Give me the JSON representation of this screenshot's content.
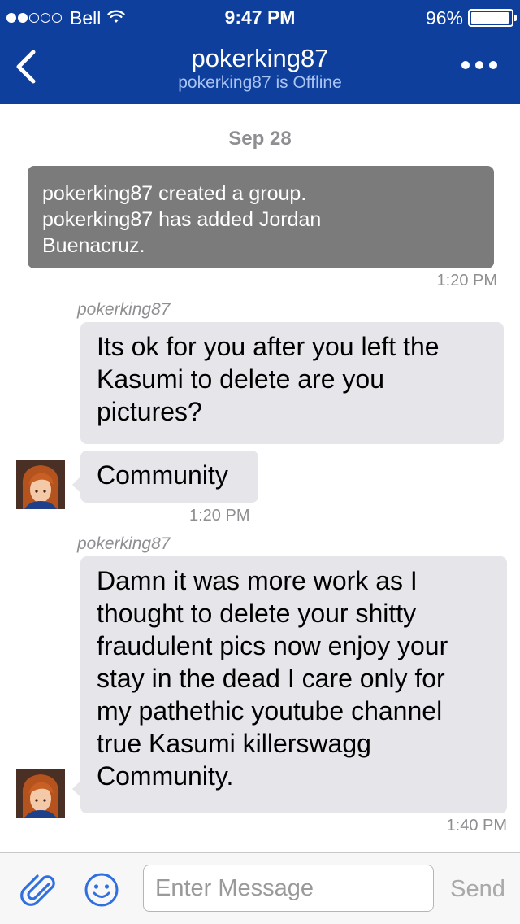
{
  "status_bar": {
    "carrier": "Bell",
    "time": "9:47 PM",
    "battery_percent": "96%",
    "battery_level": 0.96,
    "signal_bars_filled": 2,
    "signal_bars_total": 5
  },
  "nav": {
    "title": "pokerking87",
    "subtitle": "pokerking87 is Offline",
    "back_icon": "chevron-left-icon",
    "more_icon": "ellipsis-icon"
  },
  "conversation": {
    "date_separator": "Sep 28",
    "system_message": {
      "lines": [
        "pokerking87 created a group.",
        "pokerking87 has added Jordan",
        "Buenacruz."
      ],
      "time": "1:20 PM"
    },
    "groups": [
      {
        "sender": "pokerking87",
        "messages": [
          {
            "lines": [
              "Its ok for you after you left the",
              "Kasumi to delete are you",
              "pictures?"
            ]
          },
          {
            "lines": [
              "Community"
            ]
          }
        ],
        "time": "1:20 PM"
      },
      {
        "sender": "pokerking87",
        "messages": [
          {
            "lines": [
              "Damn it was more work as I",
              "thought to delete your shitty",
              "fraudulent pics now enjoy your",
              "stay in the dead I care only for",
              "my pathethic youtube channel",
              "true Kasumi killerswagg",
              "Community."
            ]
          }
        ],
        "time": "1:40 PM"
      }
    ]
  },
  "input_bar": {
    "placeholder": "Enter Message",
    "value": "",
    "send_label": "Send",
    "attach_icon": "paperclip-icon",
    "emoji_icon": "smiley-icon"
  },
  "colors": {
    "nav_background": "#0e3f9c",
    "nav_subtitle": "#a9c3f2",
    "bubble_background": "#e5e5ea",
    "system_bubble": "#7b7b7b",
    "secondary_text": "#8e8e93",
    "icon_blue": "#2f6fe0"
  }
}
